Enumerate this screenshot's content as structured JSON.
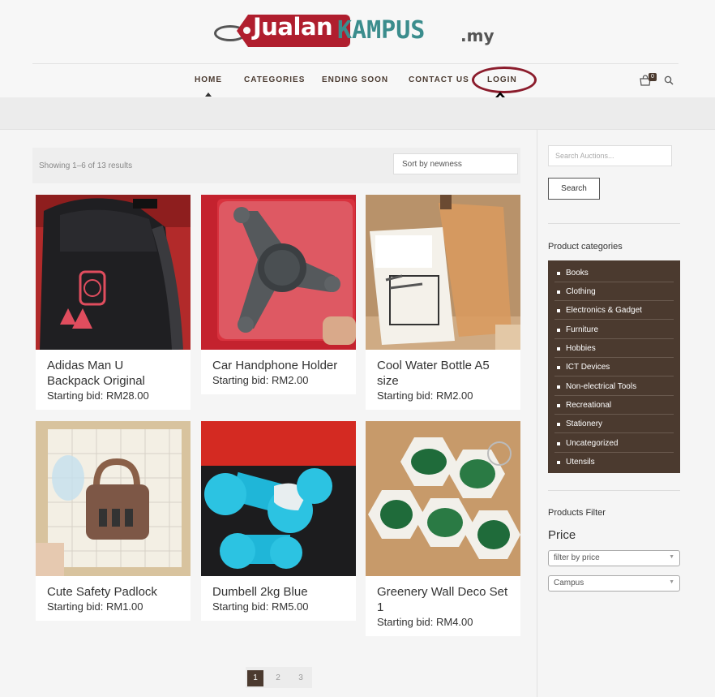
{
  "header": {
    "logo_tag": "Jualan",
    "logo_main": "KAMPUS",
    "logo_suffix": ".my",
    "nav": [
      "HOME",
      "CATEGORIES",
      "ENDING SOON",
      "CONTACT US",
      "LOGIN"
    ],
    "cart_count": "0"
  },
  "shop": {
    "result_count": "Showing 1–6 of 13 results",
    "sort_value": "Sort by newness",
    "products": [
      {
        "title": "Adidas Man U Backpack Original",
        "price": "Starting bid: RM28.00"
      },
      {
        "title": "Car Handphone Holder",
        "price": "Starting bid: RM2.00"
      },
      {
        "title": "Cool Water Bottle A5 size",
        "price": "Starting bid: RM2.00"
      },
      {
        "title": "Cute Safety Padlock",
        "price": "Starting bid: RM1.00"
      },
      {
        "title": "Dumbell 2kg Blue",
        "price": "Starting bid: RM5.00"
      },
      {
        "title": "Greenery Wall Deco Set 1",
        "price": "Starting bid: RM4.00"
      }
    ],
    "pages": [
      "1",
      "2",
      "3"
    ]
  },
  "sidebar": {
    "search_placeholder": "Search Auctions...",
    "search_button": "Search",
    "categories_heading": "Product categories",
    "categories": [
      "Books",
      "Clothing",
      "Electronics & Gadget",
      "Furniture",
      "Hobbies",
      "ICT Devices",
      "Non-electrical Tools",
      "Recreational",
      "Stationery",
      "Uncategorized",
      "Utensils"
    ],
    "filter_heading": "Products Filter",
    "price_heading": "Price",
    "price_select": "filter by price",
    "campus_select": "Campus"
  },
  "colors": {
    "accent_brown": "#4b3a2f",
    "logo_red": "#b01e2e",
    "logo_teal": "#3b8d8d",
    "annotation_circle": "#8b1c2c"
  }
}
